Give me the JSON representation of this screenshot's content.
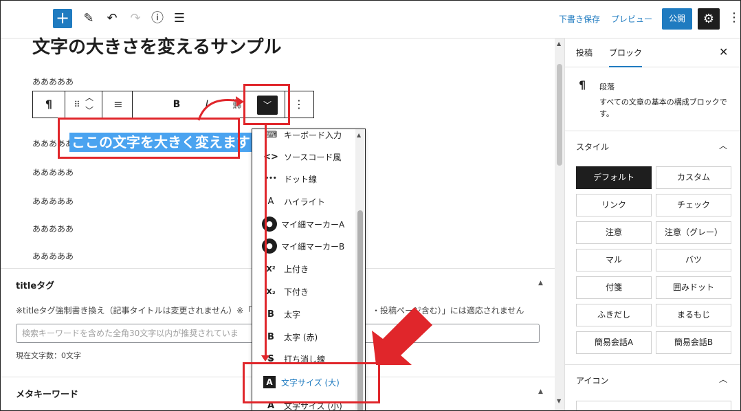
{
  "toolbar": {
    "draft_label": "下書き保存",
    "preview_label": "プレビュー",
    "publish_label": "公開"
  },
  "editor": {
    "title": "文字の大きさを変えるサンプル",
    "paragraphs": [
      "あああああ",
      "あああああ",
      "あああああ",
      "あああああ",
      "あああああ",
      "あああああ"
    ],
    "selected_text": "ここの文字を大きく変えます",
    "block_toolbar": {
      "paragraph_icon": "¶",
      "bold_label": "B",
      "italic_label": "I"
    }
  },
  "dropdown": {
    "items": [
      {
        "icon": "keyboard-icon",
        "glyph": "⌨",
        "label": "キーボード入力"
      },
      {
        "icon": "code-icon",
        "glyph": "<>",
        "label": "ソースコード風"
      },
      {
        "icon": "dotted-line-icon",
        "glyph": "•••",
        "label": "ドット線"
      },
      {
        "icon": "highlight-icon",
        "glyph": "A",
        "label": "ハイライト"
      },
      {
        "icon": "user-avatar-icon",
        "glyph": "●",
        "label": "マイ細マーカーA"
      },
      {
        "icon": "user-avatar-icon",
        "glyph": "●",
        "label": "マイ細マーカーB"
      },
      {
        "icon": "superscript-icon",
        "glyph": "X²",
        "label": "上付き"
      },
      {
        "icon": "subscript-icon",
        "glyph": "X₂",
        "label": "下付き"
      },
      {
        "icon": "bold-icon",
        "glyph": "B",
        "label": "太字"
      },
      {
        "icon": "bold-icon",
        "glyph": "B",
        "label": "太字 (赤)"
      },
      {
        "icon": "strikethrough-icon",
        "glyph": "S",
        "label": "打ち消し線"
      },
      {
        "icon": "font-size-icon",
        "glyph": "A",
        "label": "文字サイズ (大)",
        "highlighted": true
      },
      {
        "icon": "font-size-icon",
        "glyph": "A",
        "label": "文字サイズ (小)"
      }
    ]
  },
  "meta_title": {
    "heading": "titleタグ",
    "description": "※titleタグ強制書き換え（記事タイトルは変更されません）※「",
    "description_tail": "・投稿ページ含む）」には適応されません",
    "placeholder": "検索キーワードを含めた全角30文字以内が推奨されていま",
    "count": "現在文字数：0文字"
  },
  "meta_keywords": {
    "heading": "メタキーワード"
  },
  "sidebar": {
    "tab_post": "投稿",
    "tab_block": "ブロック",
    "block_icon": "¶",
    "block_name": "段落",
    "block_desc": "すべての文章の基本の構成ブロックです。",
    "style_heading": "スタイル",
    "styles": [
      "デフォルト",
      "カスタム",
      "リンク",
      "チェック",
      "注意",
      "注意（グレー）",
      "マル",
      "バツ",
      "付箋",
      "囲みドット",
      "ふきだし",
      "まるもじ",
      "簡易会話A",
      "簡易会話B"
    ],
    "icon_heading": "アイコン"
  },
  "colors": {
    "accent": "#1f7bc0",
    "annotation": "#e0262b",
    "selection": "#4aa3f0"
  }
}
